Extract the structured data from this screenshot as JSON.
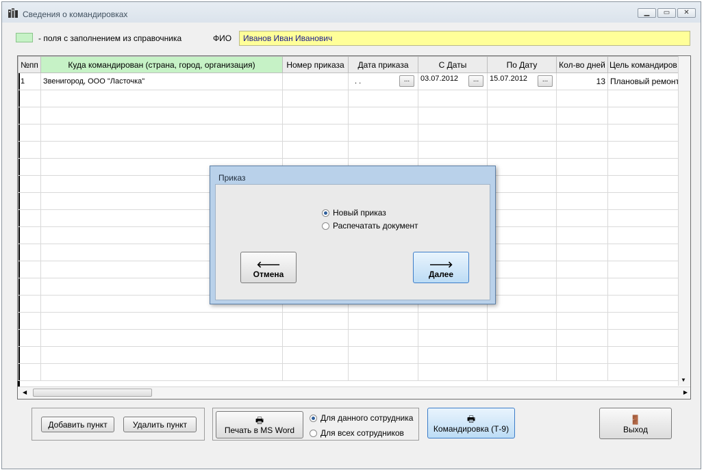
{
  "window": {
    "title": "Сведения о командировках"
  },
  "legend": {
    "text": "- поля с заполнением из справочника",
    "color": "#c6f2c6"
  },
  "fio": {
    "label": "ФИО",
    "value": "Иванов Иван Иванович"
  },
  "table": {
    "columns": [
      "№пп",
      "Куда командирован (страна, город, организация)",
      "Номер приказа",
      "Дата приказа",
      "С Даты",
      "По Дату",
      "Кол-во дней",
      "Цель командиров"
    ],
    "rows": [
      {
        "num": "1",
        "place": "Звенигород, ООО \"Ласточка\"",
        "order_num": "",
        "order_date": ". .",
        "from": "03.07.2012",
        "to": "15.07.2012",
        "days": "13",
        "purpose": "Плановый ремонт"
      }
    ],
    "picker_label": "..."
  },
  "buttons": {
    "add": "Добавить пункт",
    "delete": "Удалить пункт",
    "print_word": "Печать в MS Word",
    "trip": "Командировка (Т-9)",
    "exit": "Выход"
  },
  "print_scope": {
    "options": [
      "Для данного сотрудника",
      "Для всех сотрудников"
    ],
    "selected": 0
  },
  "dialog": {
    "title": "Приказ",
    "options": [
      "Новый приказ",
      "Распечатать документ"
    ],
    "selected": 0,
    "cancel": "Отмена",
    "next": "Далее"
  }
}
